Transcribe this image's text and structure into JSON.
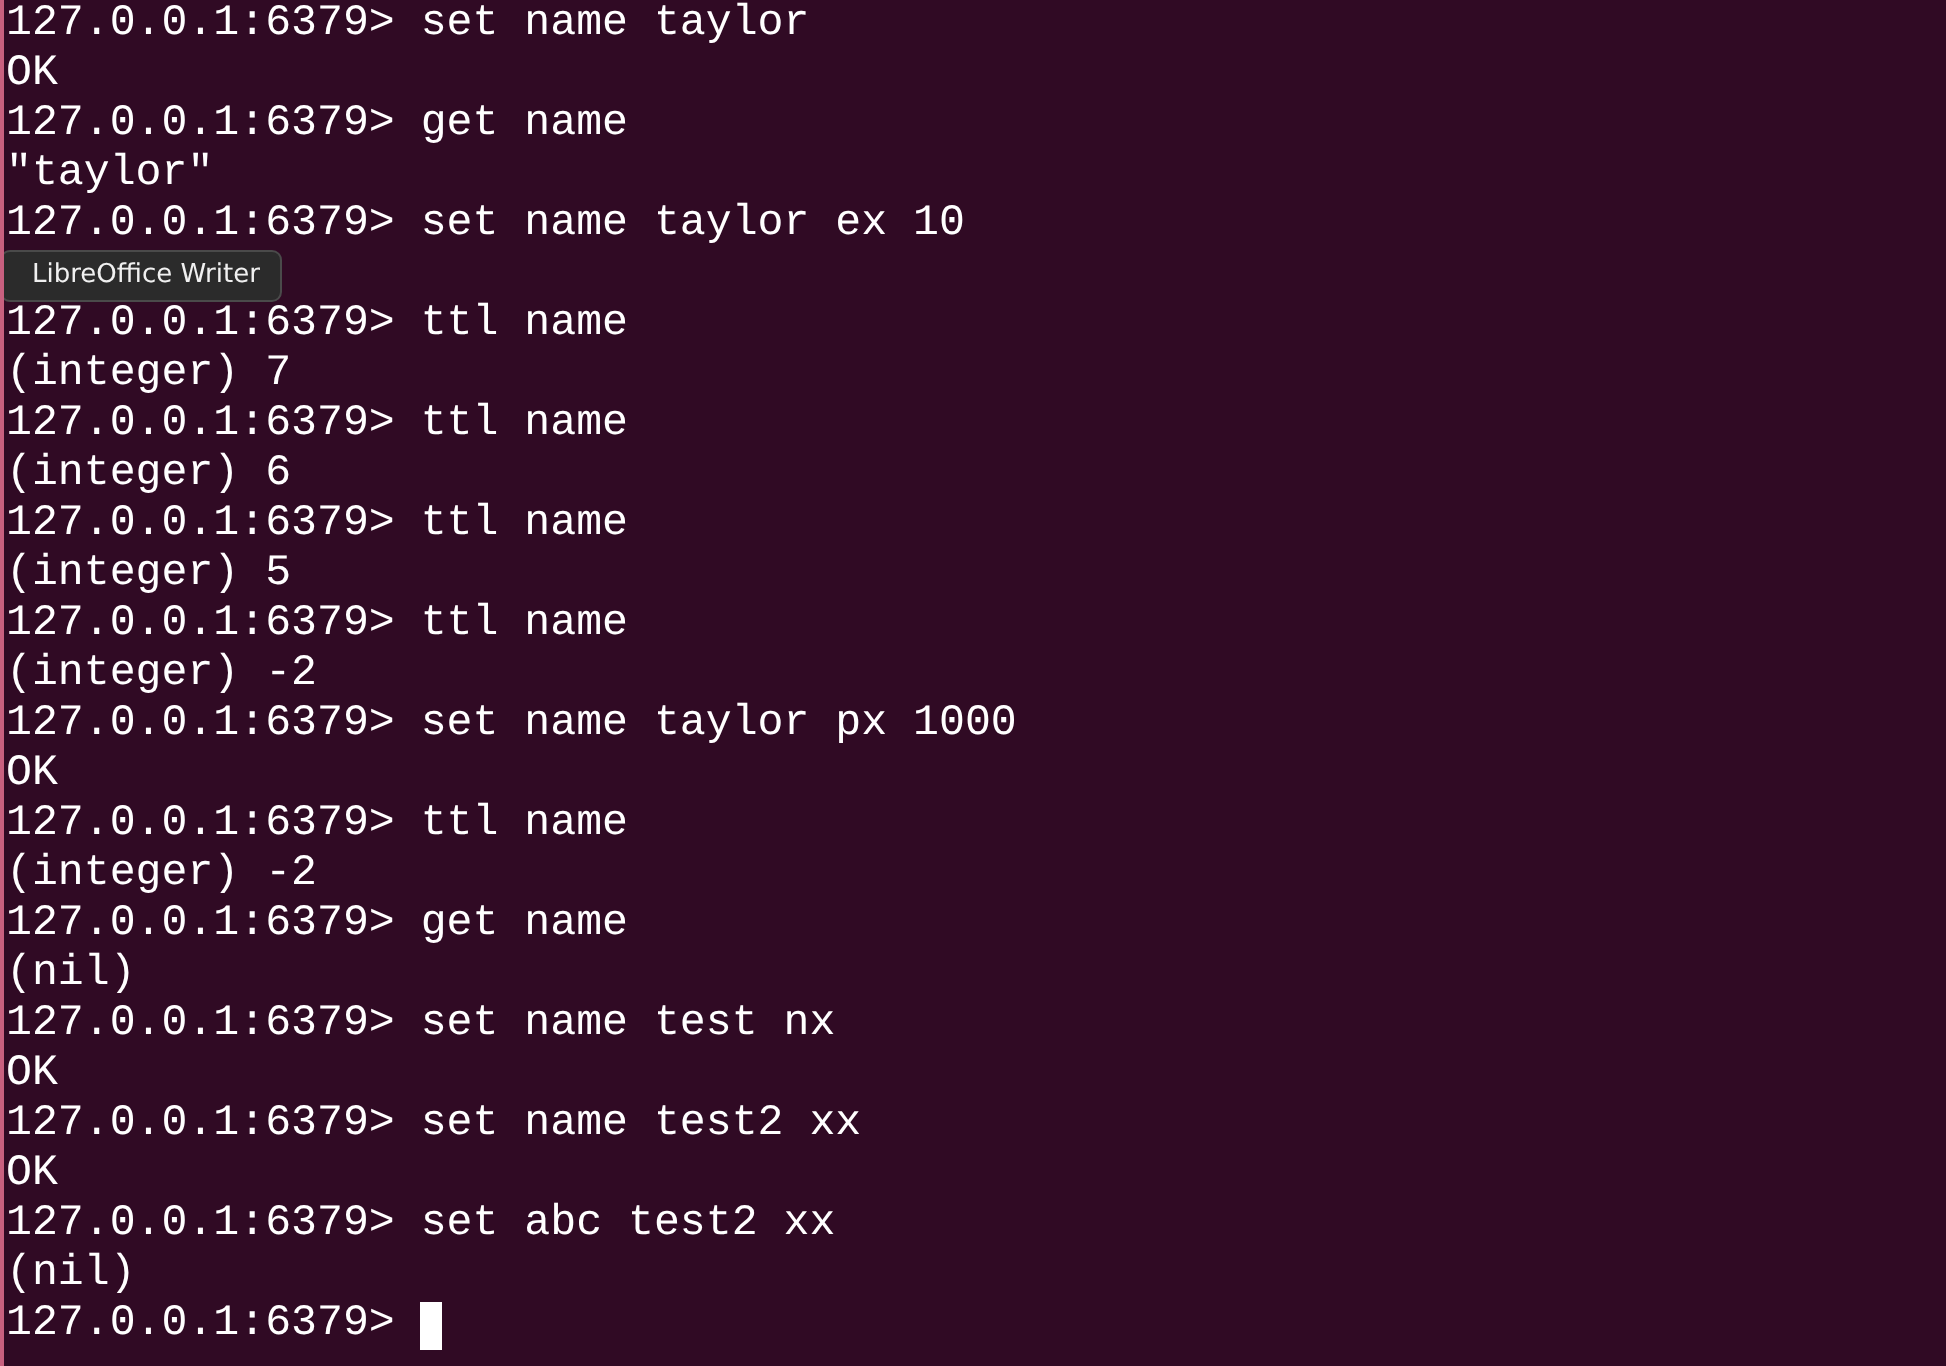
{
  "terminal": {
    "lines": [
      {
        "kind": "prompt",
        "prompt": "127.0.0.1:6379>",
        "command": "set name taylor"
      },
      {
        "kind": "output",
        "text": "OK"
      },
      {
        "kind": "prompt",
        "prompt": "127.0.0.1:6379>",
        "command": "get name"
      },
      {
        "kind": "output",
        "text": "\"taylor\""
      },
      {
        "kind": "prompt",
        "prompt": "127.0.0.1:6379>",
        "command": "set name taylor ex 10"
      },
      {
        "kind": "tooltip",
        "text": "LibreOffice Writer"
      },
      {
        "kind": "prompt",
        "prompt": "127.0.0.1:6379>",
        "command": "ttl name"
      },
      {
        "kind": "output",
        "text": "(integer) 7"
      },
      {
        "kind": "prompt",
        "prompt": "127.0.0.1:6379>",
        "command": "ttl name"
      },
      {
        "kind": "output",
        "text": "(integer) 6"
      },
      {
        "kind": "prompt",
        "prompt": "127.0.0.1:6379>",
        "command": "ttl name"
      },
      {
        "kind": "output",
        "text": "(integer) 5"
      },
      {
        "kind": "prompt",
        "prompt": "127.0.0.1:6379>",
        "command": "ttl name"
      },
      {
        "kind": "output",
        "text": "(integer) -2"
      },
      {
        "kind": "prompt",
        "prompt": "127.0.0.1:6379>",
        "command": "set name taylor px 1000"
      },
      {
        "kind": "output",
        "text": "OK"
      },
      {
        "kind": "prompt",
        "prompt": "127.0.0.1:6379>",
        "command": "ttl name"
      },
      {
        "kind": "output",
        "text": "(integer) -2"
      },
      {
        "kind": "prompt",
        "prompt": "127.0.0.1:6379>",
        "command": "get name"
      },
      {
        "kind": "output",
        "text": "(nil)"
      },
      {
        "kind": "prompt",
        "prompt": "127.0.0.1:6379>",
        "command": "set name test nx"
      },
      {
        "kind": "output",
        "text": "OK"
      },
      {
        "kind": "prompt",
        "prompt": "127.0.0.1:6379>",
        "command": "set name test2 xx"
      },
      {
        "kind": "output",
        "text": "OK"
      },
      {
        "kind": "prompt",
        "prompt": "127.0.0.1:6379>",
        "command": "set abc test2 xx"
      },
      {
        "kind": "output",
        "text": "(nil)"
      },
      {
        "kind": "prompt",
        "prompt": "127.0.0.1:6379>",
        "cursor": true
      }
    ]
  }
}
